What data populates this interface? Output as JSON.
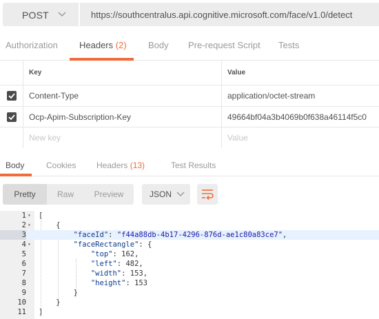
{
  "request": {
    "method": "POST",
    "url": "https://southcentralus.api.cognitive.microsoft.com/face/v1.0/detect"
  },
  "request_tabs": {
    "authorization": "Authorization",
    "headers": "Headers",
    "headers_count": "(2)",
    "body": "Body",
    "prerequest": "Pre-request Script",
    "tests": "Tests"
  },
  "headers_table": {
    "key_header": "Key",
    "value_header": "Value",
    "rows": [
      {
        "key": "Content-Type",
        "value": "application/octet-stream",
        "checked": true
      },
      {
        "key": "Ocp-Apim-Subscription-Key",
        "value": "49664bf04a3b4069b0f638a46114f5c0",
        "checked": true
      }
    ],
    "new_key_placeholder": "New key",
    "new_value_placeholder": "Value"
  },
  "response_tabs": {
    "body": "Body",
    "cookies": "Cookies",
    "headers": "Headers",
    "headers_count": "(13)",
    "test_results": "Test Results"
  },
  "view": {
    "pretty": "Pretty",
    "raw": "Raw",
    "preview": "Preview",
    "format": "JSON"
  },
  "code": {
    "line_numbers": [
      "1",
      "2",
      "3",
      "4",
      "5",
      "6",
      "7",
      "8",
      "9",
      "10",
      "11"
    ],
    "faceId_key": "\"faceId\"",
    "faceId_value": "\"f44a88db-4b17-4296-876d-ae1c80a83ce7\"",
    "faceRectangle_key": "\"faceRectangle\"",
    "top_key": "\"top\"",
    "top_value": "162",
    "left_key": "\"left\"",
    "left_value": "482",
    "width_key": "\"width\"",
    "width_value": "153",
    "height_key": "\"height\"",
    "height_value": "153"
  },
  "colors": {
    "accent": "#f26b3a",
    "highlight_line": "#e8f2ff"
  },
  "icons": [
    "chevron-down-icon",
    "checkbox-checked-icon",
    "wrap-lines-icon",
    "fold-arrow-icon"
  ]
}
